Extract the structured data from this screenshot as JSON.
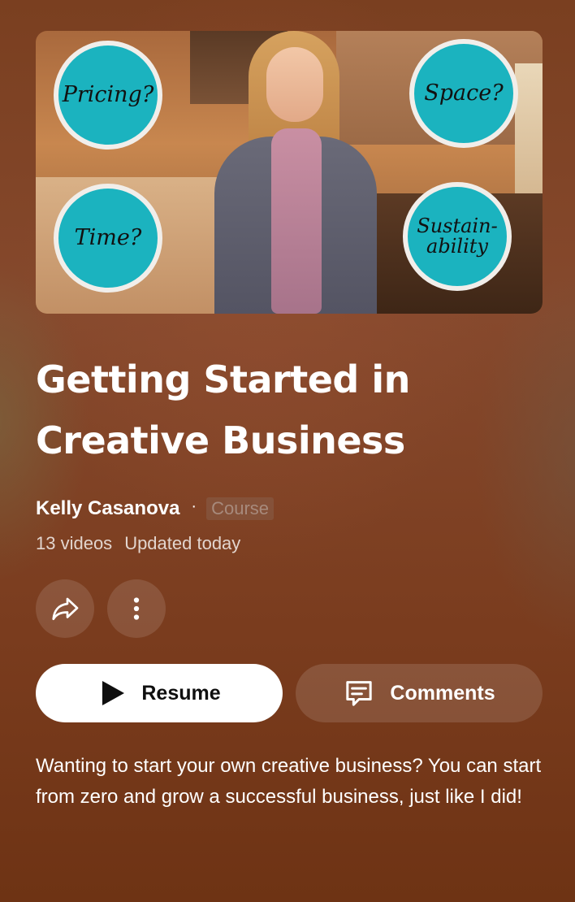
{
  "thumbnail": {
    "badges": [
      "Pricing?",
      "Space?",
      "Time?",
      "Sustain-ability"
    ]
  },
  "playlist": {
    "title": "Getting Started in Creative Business",
    "owner": "Kelly Casanova",
    "separator": "·",
    "type": "Course",
    "video_count": "13 videos",
    "updated": "Updated today",
    "description": "Wanting to start your own creative business? You can start from zero and grow a successful business, just like I did!"
  },
  "actions": {
    "share_icon": "share-icon",
    "more_icon": "more-vertical-icon",
    "resume_label": "Resume",
    "comments_label": "Comments"
  },
  "colors": {
    "badge_teal": "#1bb3bf",
    "background_brown": "#7a3f20",
    "primary_button_bg": "#ffffff"
  }
}
